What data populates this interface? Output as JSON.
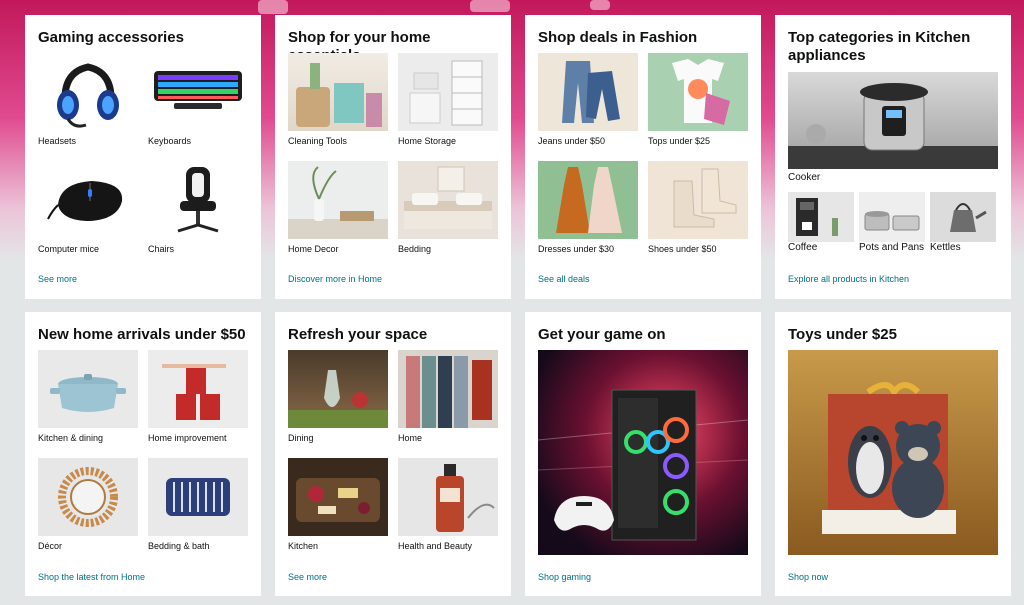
{
  "cards": [
    {
      "title": "Gaming accessories",
      "items": [
        {
          "label": "Headsets"
        },
        {
          "label": "Keyboards"
        },
        {
          "label": "Computer mice"
        },
        {
          "label": "Chairs"
        }
      ],
      "link": "See more"
    },
    {
      "title": "Shop for your home essentials",
      "items": [
        {
          "label": "Cleaning Tools"
        },
        {
          "label": "Home Storage"
        },
        {
          "label": "Home Decor"
        },
        {
          "label": "Bedding"
        }
      ],
      "link": "Discover more in Home"
    },
    {
      "title": "Shop deals in Fashion",
      "items": [
        {
          "label": "Jeans under $50"
        },
        {
          "label": "Tops under $25"
        },
        {
          "label": "Dresses under $30"
        },
        {
          "label": "Shoes under $50"
        }
      ],
      "link": "See all deals"
    },
    {
      "title": "Top categories in Kitchen appliances",
      "hero_label": "Cooker",
      "items": [
        {
          "label": "Coffee"
        },
        {
          "label": "Pots and Pans"
        },
        {
          "label": "Kettles"
        }
      ],
      "link": "Explore all products in Kitchen"
    },
    {
      "title": "New home arrivals under $50",
      "items": [
        {
          "label": "Kitchen & dining"
        },
        {
          "label": "Home improvement"
        },
        {
          "label": "Décor"
        },
        {
          "label": "Bedding & bath"
        }
      ],
      "link": "Shop the latest from Home"
    },
    {
      "title": "Refresh your space",
      "items": [
        {
          "label": "Dining"
        },
        {
          "label": "Home"
        },
        {
          "label": "Kitchen"
        },
        {
          "label": "Health and Beauty"
        }
      ],
      "link": "See more"
    },
    {
      "title": "Get your game on",
      "link": "Shop gaming"
    },
    {
      "title": "Toys under $25",
      "link": "Shop now"
    }
  ],
  "colors": {
    "link": "#007185",
    "text": "#0f1111",
    "hero": "#c2185b"
  }
}
